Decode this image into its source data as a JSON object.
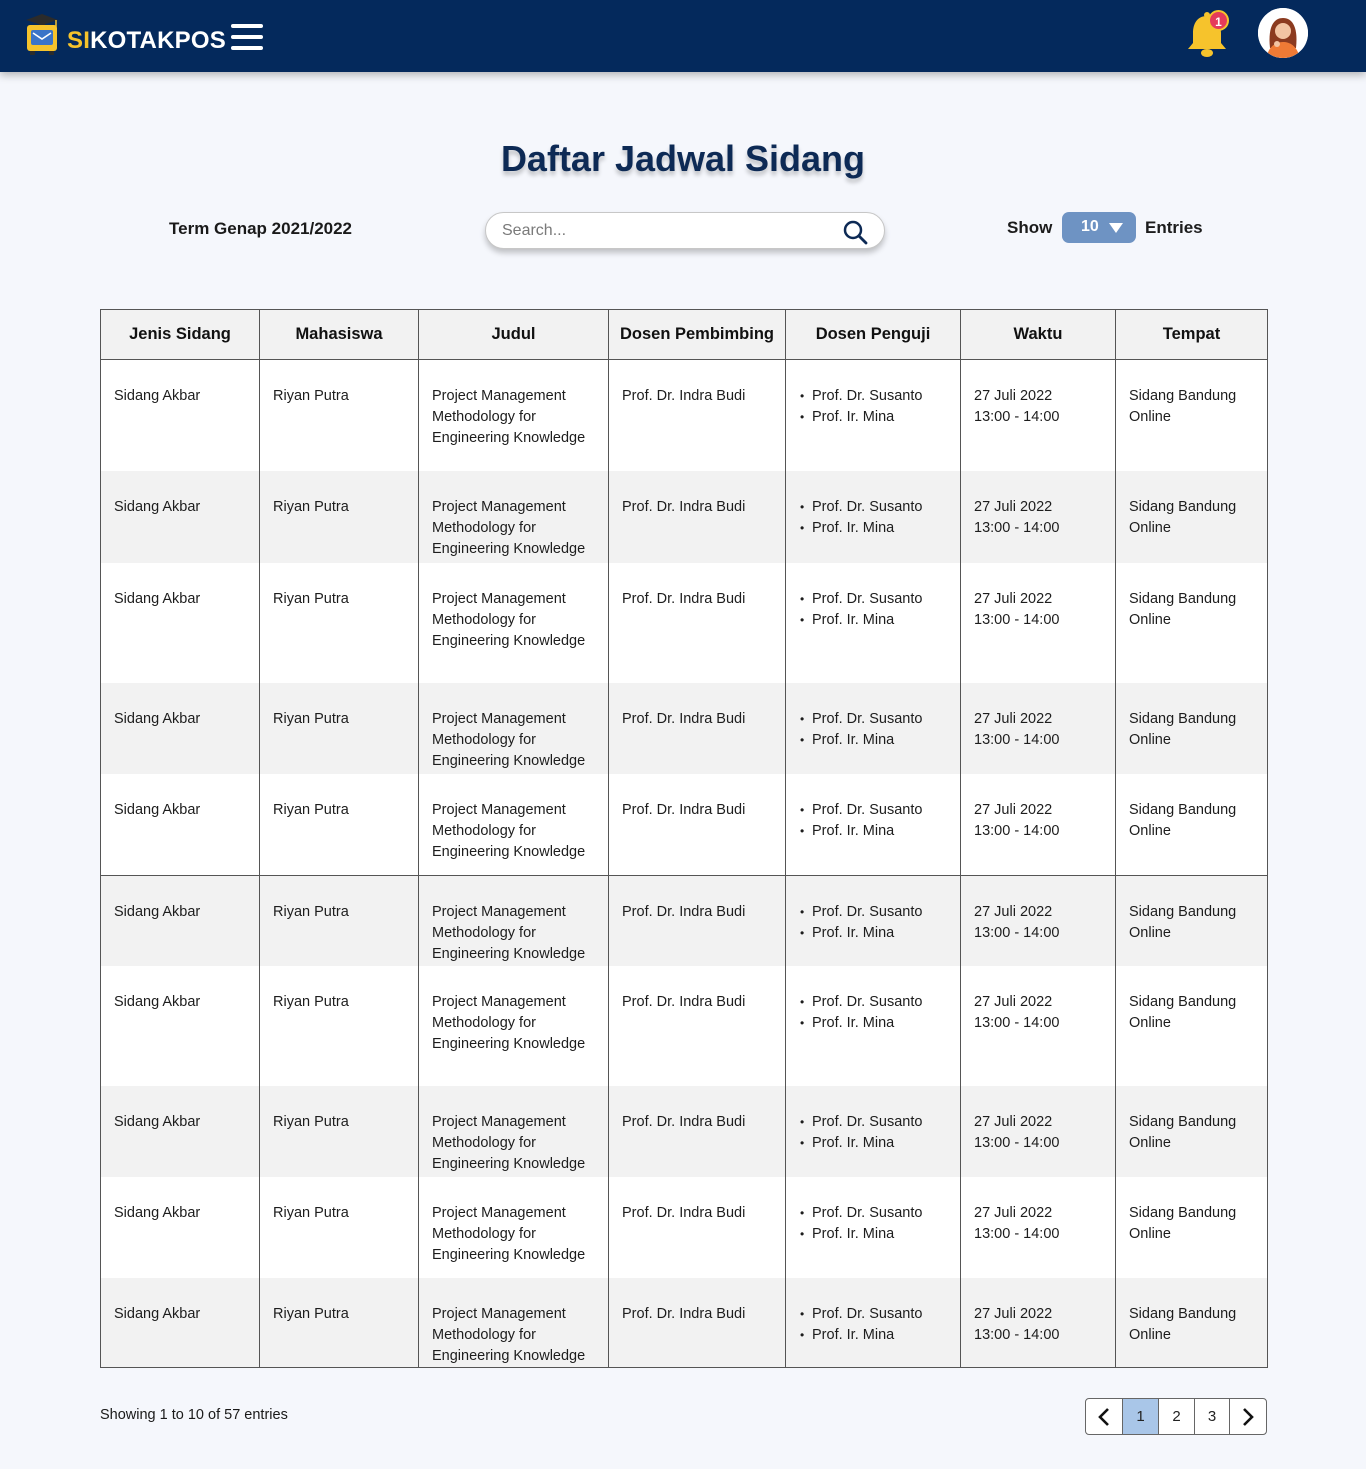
{
  "app": {
    "brand_prefix": "SI",
    "brand_suffix": "KOTAKPOS",
    "notification_count": "1"
  },
  "page": {
    "title": "Daftar Jadwal Sidang",
    "term": "Term Genap 2021/2022"
  },
  "search": {
    "placeholder": "Search..."
  },
  "entries": {
    "show_label": "Show",
    "value": "10",
    "entries_label": "Entries"
  },
  "table": {
    "headers": [
      "Jenis Sidang",
      "Mahasiswa",
      "Judul",
      "Dosen Pembimbing",
      "Dosen Penguji",
      "Waktu",
      "Tempat"
    ],
    "rows": [
      {
        "jenis": "Sidang Akbar",
        "mahasiswa": "Riyan Putra",
        "judul": "Project Management Methodology for Engineering Knowledge",
        "pembimbing": "Prof. Dr. Indra Budi",
        "penguji": [
          "Prof. Dr. Susanto",
          "Prof. Ir. Mina"
        ],
        "tanggal": "27 Juli 2022",
        "jam": "13:00 - 14:00",
        "tempat": "Sidang Bandung Online"
      },
      {
        "jenis": "Sidang Akbar",
        "mahasiswa": "Riyan Putra",
        "judul": "Project Management Methodology for Engineering Knowledge",
        "pembimbing": "Prof. Dr. Indra Budi",
        "penguji": [
          "Prof. Dr. Susanto",
          "Prof. Ir. Mina"
        ],
        "tanggal": "27 Juli 2022",
        "jam": "13:00 - 14:00",
        "tempat": "Sidang Bandung Online"
      },
      {
        "jenis": "Sidang Akbar",
        "mahasiswa": "Riyan Putra",
        "judul": "Project Management Methodology for Engineering Knowledge",
        "pembimbing": "Prof. Dr. Indra Budi",
        "penguji": [
          "Prof. Dr. Susanto",
          "Prof. Ir. Mina"
        ],
        "tanggal": "27 Juli 2022",
        "jam": "13:00 - 14:00",
        "tempat": "Sidang Bandung Online"
      },
      {
        "jenis": "Sidang Akbar",
        "mahasiswa": "Riyan Putra",
        "judul": "Project Management Methodology for Engineering Knowledge",
        "pembimbing": "Prof. Dr. Indra Budi",
        "penguji": [
          "Prof. Dr. Susanto",
          "Prof. Ir. Mina"
        ],
        "tanggal": "27 Juli 2022",
        "jam": "13:00 - 14:00",
        "tempat": "Sidang Bandung Online"
      },
      {
        "jenis": "Sidang Akbar",
        "mahasiswa": "Riyan Putra",
        "judul": "Project Management Methodology for Engineering Knowledge",
        "pembimbing": "Prof. Dr. Indra Budi",
        "penguji": [
          "Prof. Dr. Susanto",
          "Prof. Ir. Mina"
        ],
        "tanggal": "27 Juli 2022",
        "jam": "13:00 - 14:00",
        "tempat": "Sidang Bandung Online"
      },
      {
        "jenis": "Sidang Akbar",
        "mahasiswa": "Riyan Putra",
        "judul": "Project Management Methodology for Engineering Knowledge",
        "pembimbing": "Prof. Dr. Indra Budi",
        "penguji": [
          "Prof. Dr. Susanto",
          "Prof. Ir. Mina"
        ],
        "tanggal": "27 Juli 2022",
        "jam": "13:00 - 14:00",
        "tempat": "Sidang Bandung Online"
      },
      {
        "jenis": "Sidang Akbar",
        "mahasiswa": "Riyan Putra",
        "judul": "Project Management Methodology for Engineering Knowledge",
        "pembimbing": "Prof. Dr. Indra Budi",
        "penguji": [
          "Prof. Dr. Susanto",
          "Prof. Ir. Mina"
        ],
        "tanggal": "27 Juli 2022",
        "jam": "13:00 - 14:00",
        "tempat": "Sidang Bandung Online"
      },
      {
        "jenis": "Sidang Akbar",
        "mahasiswa": "Riyan Putra",
        "judul": "Project Management Methodology for Engineering Knowledge",
        "pembimbing": "Prof. Dr. Indra Budi",
        "penguji": [
          "Prof. Dr. Susanto",
          "Prof. Ir. Mina"
        ],
        "tanggal": "27 Juli 2022",
        "jam": "13:00 - 14:00",
        "tempat": "Sidang Bandung Online"
      },
      {
        "jenis": "Sidang Akbar",
        "mahasiswa": "Riyan Putra",
        "judul": "Project Management Methodology for Engineering Knowledge",
        "pembimbing": "Prof. Dr. Indra Budi",
        "penguji": [
          "Prof. Dr. Susanto",
          "Prof. Ir. Mina"
        ],
        "tanggal": "27 Juli 2022",
        "jam": "13:00 - 14:00",
        "tempat": "Sidang Bandung Online"
      },
      {
        "jenis": "Sidang Akbar",
        "mahasiswa": "Riyan Putra",
        "judul": "Project Management Methodology for Engineering Knowledge",
        "pembimbing": "Prof. Dr. Indra Budi",
        "penguji": [
          "Prof. Dr. Susanto",
          "Prof. Ir. Mina"
        ],
        "tanggal": "27 Juli 2022",
        "jam": "13:00 - 14:00",
        "tempat": "Sidang Bandung Online"
      }
    ]
  },
  "footer": {
    "showing": "Showing 1 to 10 of 57 entries"
  },
  "pagination": {
    "pages": [
      "1",
      "2",
      "3"
    ],
    "active": "1"
  },
  "icons": {
    "logo": "mailbox-graduation-cap-icon",
    "menu": "hamburger-menu-icon",
    "notifications": "bell-icon",
    "search": "search-icon",
    "dropdown": "caret-down-icon",
    "prev": "chevron-left-icon",
    "next": "chevron-right-icon"
  },
  "colors": {
    "navbar": "#04295c",
    "brand_accent": "#f6c32c",
    "title": "#0d2a55",
    "select_bg": "#6e93c3",
    "active_page": "#a9c6e8",
    "badge": "#e53b5a"
  }
}
